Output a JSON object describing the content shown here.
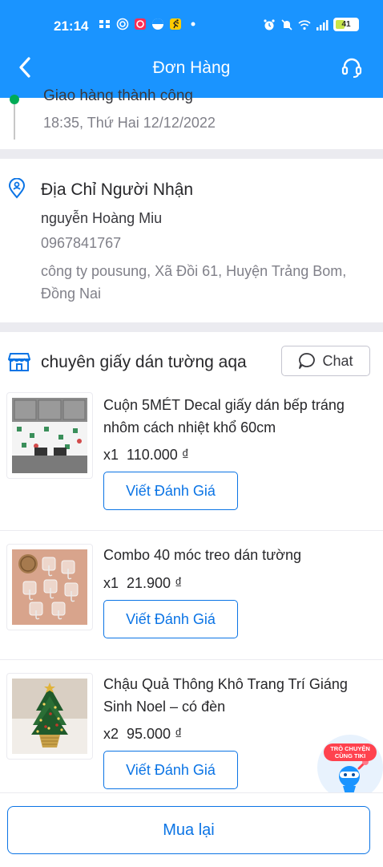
{
  "status_bar": {
    "time": "21:14",
    "battery": "41",
    "battery_fraction": 0.41
  },
  "header": {
    "title": "Đơn Hàng",
    "back_icon": "chevron-left-icon",
    "support_icon": "headset-icon"
  },
  "timeline": {
    "partial_text": "Giao hàng thành công",
    "time": "18:35, Thứ Hai 12/12/2022"
  },
  "address": {
    "title": "Địa Chỉ Người Nhận",
    "name": "nguyễn Hoàng Miu",
    "phone": "0967841767",
    "address": "công ty pousung, Xã Đồi 61, Huyện Trảng Bom, Đồng Nai"
  },
  "shop": {
    "name": "chuyên giấy dán tường aqa",
    "chat_label": "Chat"
  },
  "products": [
    {
      "name": "Cuộn 5MÉT Decal giấy dán bếp tráng nhôm cách nhiệt khổ 60cm",
      "qty": "x1",
      "price": "110.000 ₫",
      "review_label": "Viết Đánh Giá"
    },
    {
      "name": "Combo 40 móc treo dán tường",
      "qty": "x1",
      "price": "21.900 ₫",
      "review_label": "Viết Đánh Giá"
    },
    {
      "name": "Chậu Quả Thông Khô Trang Trí Giáng Sinh Noel – có đèn",
      "qty": "x2",
      "price": "95.000 ₫",
      "review_label": "Viết Đánh Giá"
    }
  ],
  "chat_widget": {
    "label": "TRÒ CHUYỆN CÙNG TIKI"
  },
  "bottom": {
    "rebuy_label": "Mua lại"
  },
  "colors": {
    "primary": "#1a94ff",
    "button_blue": "#0b74e5",
    "separator": "#ebebf0",
    "timeline_dot": "#00ab56"
  }
}
